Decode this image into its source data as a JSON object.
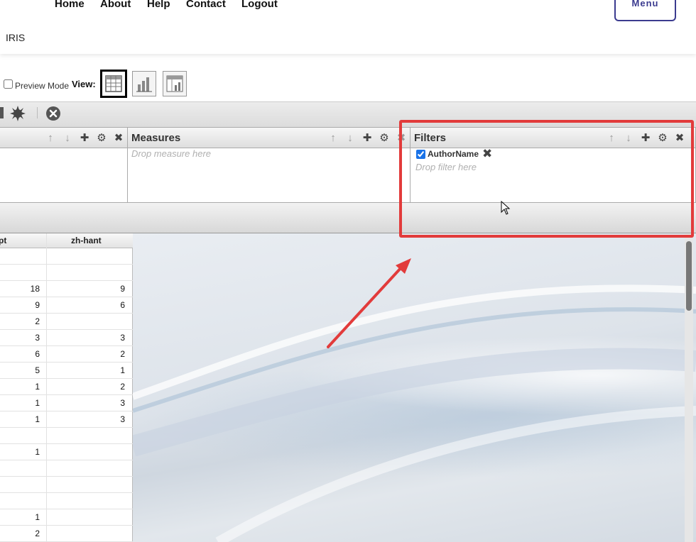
{
  "header": {
    "nav": [
      "Home",
      "About",
      "Help",
      "Contact",
      "Logout"
    ],
    "menu_label": "Menu",
    "brand": "IRIS"
  },
  "viewbar": {
    "preview_label": "Preview Mode",
    "preview_checked": false,
    "view_label": "View:",
    "views": [
      "table-view-icon",
      "chart-view-icon",
      "combined-view-icon"
    ],
    "active_view": "table-view-icon"
  },
  "zones": {
    "measures": {
      "title": "Measures",
      "hint": "Drop measure here"
    },
    "filters": {
      "title": "Filters",
      "hint": "Drop filter here",
      "items": [
        {
          "label": "AuthorName",
          "checked": true
        }
      ]
    }
  },
  "grid": {
    "columns": [
      "pt",
      "zh-hant"
    ],
    "rows": [
      [
        "",
        ""
      ],
      [
        "",
        ""
      ],
      [
        "18",
        "9"
      ],
      [
        "9",
        "6"
      ],
      [
        "2",
        ""
      ],
      [
        "3",
        "3"
      ],
      [
        "6",
        "2"
      ],
      [
        "5",
        "1"
      ],
      [
        "1",
        "2"
      ],
      [
        "1",
        "3"
      ],
      [
        "1",
        "3"
      ],
      [
        "",
        ""
      ],
      [
        "1",
        ""
      ],
      [
        "",
        ""
      ],
      [
        "",
        ""
      ],
      [
        "",
        ""
      ],
      [
        "1",
        ""
      ],
      [
        "2",
        ""
      ]
    ]
  },
  "colors": {
    "highlight": "#e23b3b",
    "menu_border": "#3b3b8f"
  }
}
